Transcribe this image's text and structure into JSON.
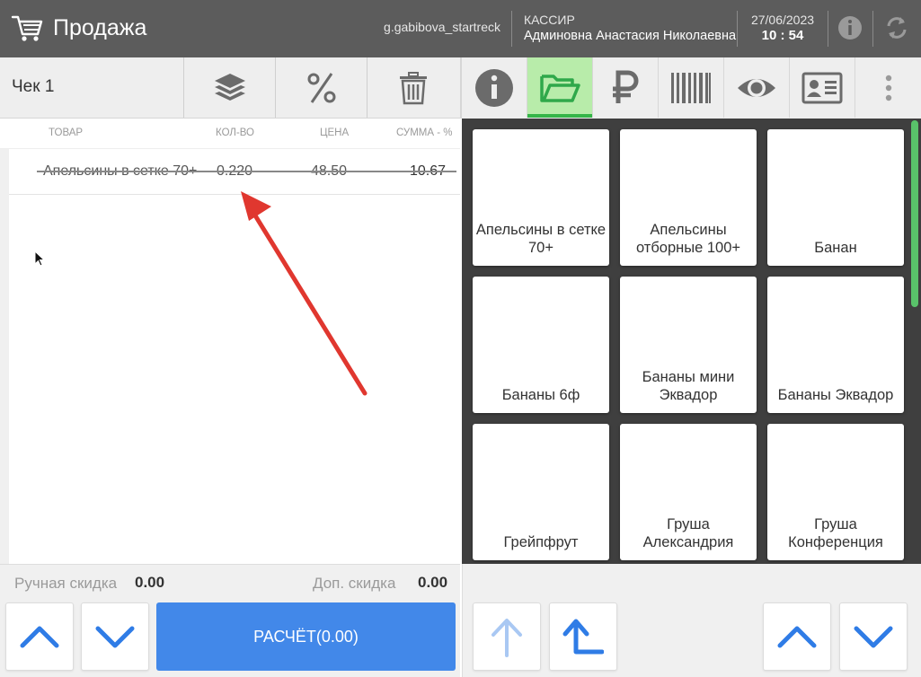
{
  "header": {
    "title": "Продажа",
    "username": "g.gabibova_startreck",
    "role": "КАССИР",
    "fullname": "Админовна Анастасия Николаевна",
    "date": "27/06/2023",
    "time": "10 : 54"
  },
  "left_toolbar": {
    "check_label": "Чек 1",
    "buttons": [
      "layers-icon",
      "percent-icon",
      "trash-icon"
    ]
  },
  "columns": {
    "product": "ТОВАР",
    "qty": "КОЛ-ВО",
    "price": "ЦЕНА",
    "sum": "СУММА - %"
  },
  "items": [
    {
      "name": "Апельсины в сетке 70+",
      "qty": "0.220",
      "price": "48.50",
      "sum": "10.67",
      "cancelled": true
    }
  ],
  "discounts": {
    "manual_label": "Ручная скидка",
    "manual_value": "0.00",
    "extra_label": "Доп. скидка",
    "extra_value": "0.00"
  },
  "pay_button": "РАСЧЁТ(0.00)",
  "right_toolbar": {
    "buttons": [
      "info-icon",
      "folder-open-icon",
      "ruble-icon",
      "barcode-icon",
      "eye-icon",
      "id-card-icon",
      "more-vertical-icon"
    ],
    "active": "folder-open-icon"
  },
  "products": [
    "Апельсины в сетке 70+",
    "Апельсины отборные 100+",
    "Банан",
    "Бананы 6ф",
    "Бананы мини Эквадор",
    "Бананы Эквадор",
    "Грейпфрут",
    "Груша Александрия",
    "Груша Конференция"
  ],
  "colors": {
    "header_bg": "#5c5c5c",
    "accent_blue": "#4288e9",
    "active_green": "#34b548",
    "active_green_bg": "#b8ecaa",
    "annotation_red": "#e0372f",
    "grid_bg": "#3f3f3f"
  }
}
